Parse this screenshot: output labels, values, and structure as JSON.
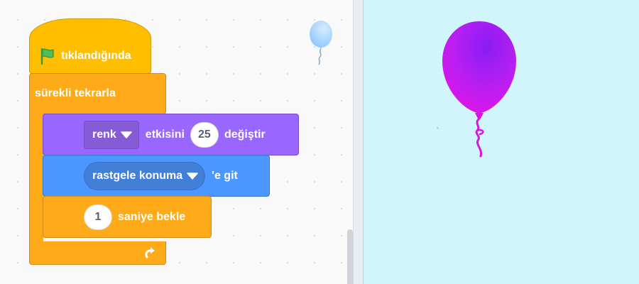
{
  "script": {
    "when_flag_clicked_label": "tıklandığında",
    "forever_label": "sürekli tekrarla",
    "change_effect": {
      "effect_value": "renk",
      "mid_label": "etkisini",
      "amount": "25",
      "end_label": "değiştir"
    },
    "goto": {
      "target_value": "rastgele konuma",
      "end_label": "'e git"
    },
    "wait": {
      "seconds": "1",
      "end_label": "saniye bekle"
    }
  },
  "icons": {
    "green_flag": "green-flag-icon",
    "dropdown_caret": "caret-down-icon",
    "loop_arrow": "repeat-arrow-icon",
    "sprite_thumbnail": "balloon-icon",
    "sprite": "balloon-sprite"
  },
  "colors": {
    "events": "#ffbf00",
    "control": "#ffab19",
    "looks": "#9966ff",
    "motion": "#4c97ff",
    "stage_bg": "#d0f5fc",
    "balloon": "#b81ff0"
  }
}
